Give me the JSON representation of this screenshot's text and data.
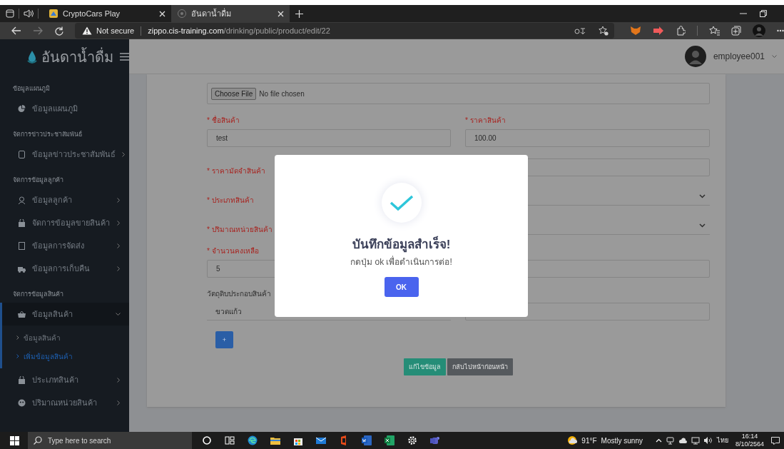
{
  "browser": {
    "tabs": [
      {
        "title": "CryptoCars Play",
        "selected": false
      },
      {
        "title": "อันดาน้ำดื่ม",
        "selected": true
      }
    ],
    "address": {
      "security": "Not secure",
      "host": "zippo.cis-training.com",
      "path": "/drinking/public/product/edit/22"
    }
  },
  "app": {
    "brand": "อันดาน้ำดื่ม",
    "user": "employee001"
  },
  "sidebar": {
    "sections": [
      {
        "title": "ข้อมูลแผนภูมิ",
        "items": [
          {
            "label": "ข้อมูลแผนภูมิ"
          }
        ]
      },
      {
        "title": "จัดการข่าวประชาสัมพันธ์",
        "items": [
          {
            "label": "ข้อมูลข่าวประชาสัมพันธ์",
            "expanded": false
          }
        ]
      },
      {
        "title": "จัดการข้อมูลลูกค้า",
        "items": [
          {
            "label": "ข้อมูลลูกค้า",
            "expanded": false
          },
          {
            "label": "จัดการข้อมูลขายสินค้า",
            "expanded": false
          },
          {
            "label": "ข้อมูลการจัดส่ง",
            "expanded": false
          },
          {
            "label": "ข้อมูลการเก็บคืน",
            "expanded": false
          }
        ]
      },
      {
        "title": "จัดการข้อมูลสินค้า",
        "items": [
          {
            "label": "ข้อมูลสินค้า",
            "expanded": true,
            "children": [
              {
                "label": "ข้อมูลสินค้า",
                "selected": false
              },
              {
                "label": "เพิ่มข้อมูลสินค้า",
                "selected": true
              }
            ]
          },
          {
            "label": "ประเภทสินค้า",
            "expanded": false
          },
          {
            "label": "ปริมาณหน่วยสินค้า",
            "expanded": false
          }
        ]
      }
    ]
  },
  "form": {
    "file": {
      "button": "Choose File",
      "status": "No file chosen"
    },
    "rows": [
      [
        {
          "label": "* ชื่อสินค้า",
          "required": true,
          "kind": "text",
          "value": "test"
        },
        {
          "label": "* ราคาสินค้า",
          "required": true,
          "kind": "text",
          "value": "100.00"
        }
      ],
      [
        {
          "label": "* ราคามัดจำสินค้า",
          "required": true
        },
        {
          "kind": "text"
        }
      ],
      [
        {
          "label": "* ประเภทสินค้า",
          "required": true
        },
        {
          "kind": "select"
        }
      ],
      [
        {
          "label": "* ปริมาณหน่วยสินค้า",
          "required": true
        },
        {
          "kind": "select"
        }
      ],
      [
        {
          "label": "* จำนวนคงเหลือ",
          "required": true,
          "kind": "text",
          "value": "5"
        },
        {
          "kind": "text"
        }
      ],
      [
        {
          "label": "วัตถุดิบประกอบสินค้า",
          "required": false,
          "kind": "line-select",
          "value": "ขวดแก้ว"
        },
        {
          "kind": "text"
        }
      ]
    ],
    "add_button": "+",
    "buttons": [
      {
        "label": "แก้ไขข้อมูล",
        "kind": "primary"
      },
      {
        "label": "กลับไปหน้าก่อนหน้า",
        "kind": "secondary"
      }
    ]
  },
  "modal": {
    "title": "บันทึกข้อมูลสำเร็จ!",
    "message": "กดปุ่ม ok เพื่อดำเนินการต่อ!",
    "button": "OK"
  },
  "taskbar": {
    "search_placeholder": "Type here to search",
    "weather": {
      "temperature": "91°F",
      "condition": "Mostly sunny"
    },
    "language": "ไทย",
    "time": "16:14",
    "date": "8/10/2564"
  }
}
